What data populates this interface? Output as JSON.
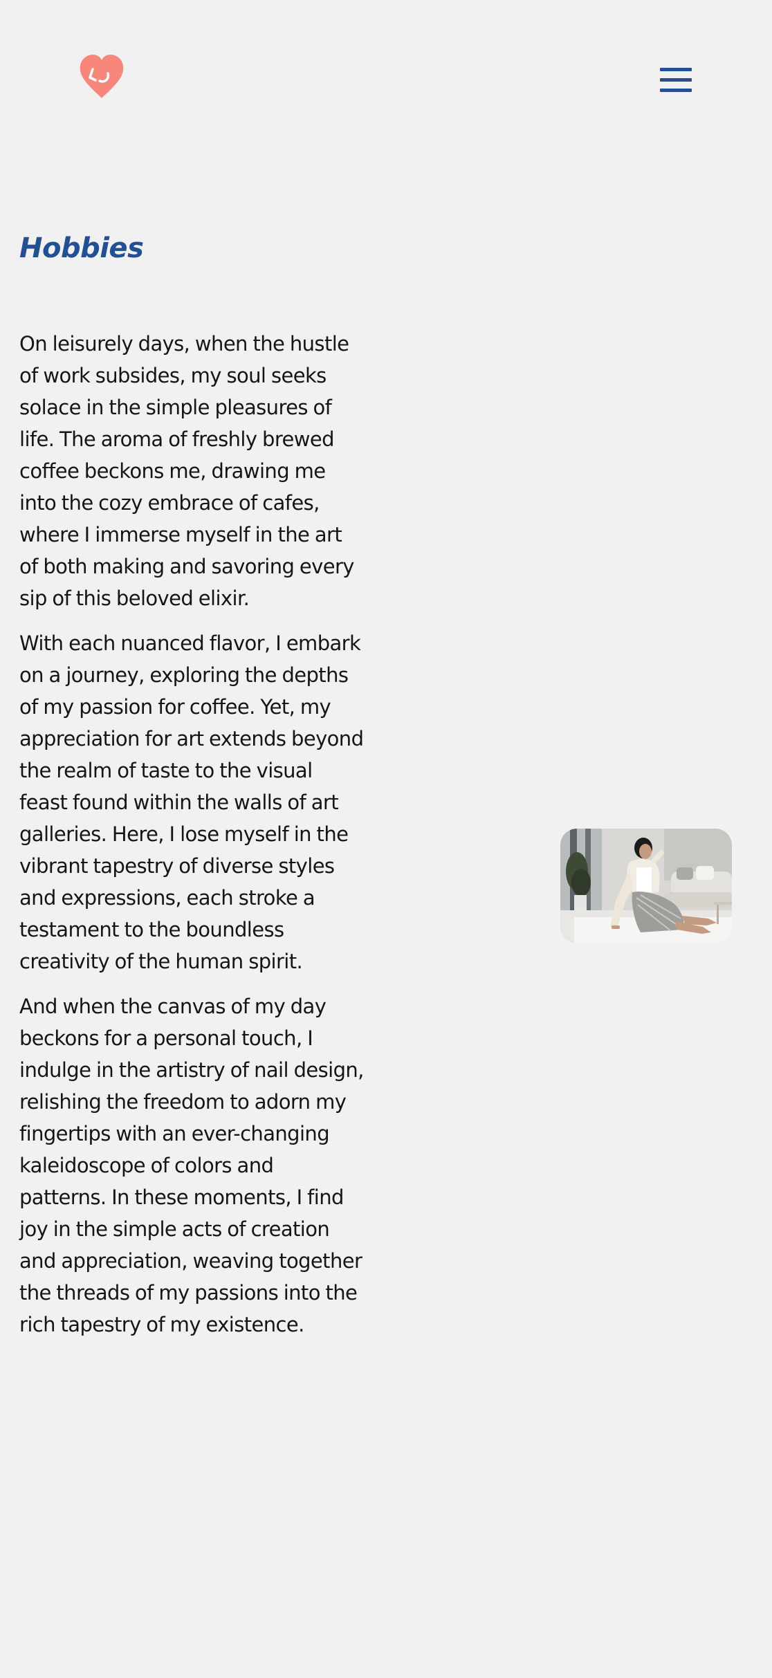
{
  "header": {
    "logo_icon": "heart-logo-icon",
    "logo_color": "#f7877b",
    "menu_icon": "hamburger-menu-icon",
    "menu_color": "#234f93"
  },
  "main": {
    "title": "Hobbies",
    "paragraphs": [
      "On leisurely days, when the hustle of work subsides, my soul seeks solace in the simple pleasures of life. The aroma of freshly brewed coffee beckons me, drawing me into the cozy embrace of cafes, where I immerse myself in the art of both making and savoring every sip of this beloved elixir.",
      "With each nuanced flavor, I embark on a journey, exploring the depths of my passion for coffee. Yet, my appreciation for art extends beyond the realm of taste to the visual feast found within the walls of art galleries. Here, I lose myself in the vibrant tapestry of diverse styles and expressions, each stroke a testament to the boundless creativity of the human spirit.",
      "And when the canvas of my day beckons for a personal touch, I indulge in the artistry of nail design, relishing the freedom to adorn my fingertips with an ever-changing kaleidoscope of colors and patterns. In these moments, I find joy in the simple acts of creation and appreciation, weaving together the threads of my passions into the rich tapestry of my existence."
    ],
    "photo_subject": "woman-sitting-on-floor-photo"
  },
  "colors": {
    "background": "#f1f1f1",
    "accent": "#234f93",
    "logo": "#f7877b",
    "text": "#151515"
  }
}
